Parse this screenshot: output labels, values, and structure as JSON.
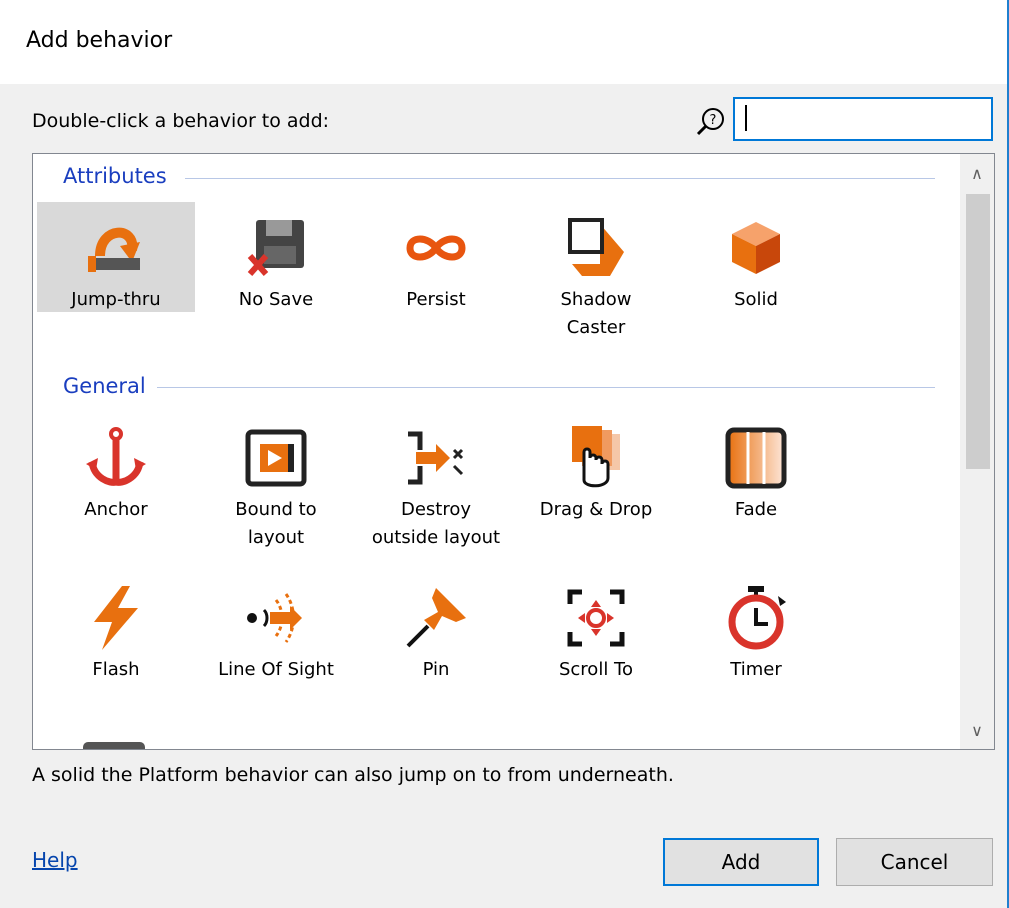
{
  "dialog": {
    "title": "Add behavior"
  },
  "prompt": "Double-click a behavior to add:",
  "search": {
    "value": "",
    "placeholder": ""
  },
  "groups": [
    {
      "name": "Attributes",
      "items": [
        {
          "label": "Jump-thru",
          "icon": "jump-thru-icon",
          "selected": true
        },
        {
          "label": "No Save",
          "icon": "no-save-icon"
        },
        {
          "label": "Persist",
          "icon": "infinity-icon"
        },
        {
          "label": "Shadow\nCaster",
          "icon": "shadow-caster-icon"
        },
        {
          "label": "Solid",
          "icon": "solid-cube-icon"
        }
      ]
    },
    {
      "name": "General",
      "items": [
        {
          "label": "Anchor",
          "icon": "anchor-icon"
        },
        {
          "label": "Bound to\nlayout",
          "icon": "bound-to-layout-icon"
        },
        {
          "label": "Destroy\noutside layout",
          "icon": "destroy-outside-layout-icon"
        },
        {
          "label": "Drag & Drop",
          "icon": "drag-drop-icon"
        },
        {
          "label": "Fade",
          "icon": "fade-icon"
        },
        {
          "label": "Flash",
          "icon": "lightning-icon"
        },
        {
          "label": "Line Of Sight",
          "icon": "line-of-sight-icon"
        },
        {
          "label": "Pin",
          "icon": "pin-icon"
        },
        {
          "label": "Scroll To",
          "icon": "scroll-to-icon"
        },
        {
          "label": "Timer",
          "icon": "timer-icon"
        }
      ]
    }
  ],
  "description": "A solid the Platform behavior can also jump on to from underneath.",
  "footer": {
    "help": "Help",
    "add": "Add",
    "cancel": "Cancel"
  },
  "colors": {
    "accent": "#e8700f",
    "accent_dark": "#c0390b",
    "focus": "#0078d7",
    "group_header": "#1a3ebf"
  }
}
